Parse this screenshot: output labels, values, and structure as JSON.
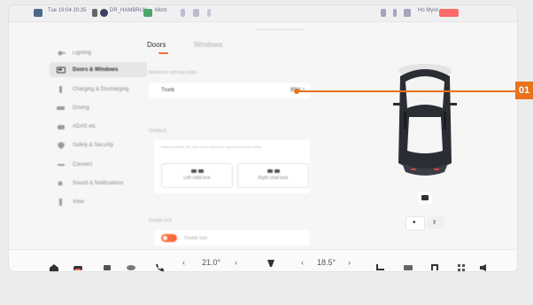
{
  "status_bar": {
    "time": "Tue 19:04 20:35",
    "driver": "DR_HAMBRUK",
    "network": "Mont",
    "right_label": "Ho Myrd",
    "brand_accent": "#ff6a3d"
  },
  "sidebar": {
    "items": [
      {
        "label": "Lighting",
        "icon": "light-icon"
      },
      {
        "label": "Doors & Windows",
        "icon": "car-door-icon"
      },
      {
        "label": "Charging & Discharging",
        "icon": "plug-icon"
      },
      {
        "label": "Driving",
        "icon": "steering-icon"
      },
      {
        "label": "ADAS etc",
        "icon": "adas-icon"
      },
      {
        "label": "Safety & Security",
        "icon": "shield-icon"
      },
      {
        "label": "Connect",
        "icon": "link-icon"
      },
      {
        "label": "Sound & Notifications",
        "icon": "speaker-icon"
      },
      {
        "label": "View",
        "icon": "info-icon"
      }
    ],
    "active_index": 1
  },
  "tabs": [
    {
      "label": "Doors",
      "active": true
    },
    {
      "label": "Windows",
      "active": false
    }
  ],
  "main": {
    "opening_angle_label": "Maximum opening angle",
    "trunk_label": "Trunk",
    "trunk_value": "85%",
    "trunk_chevron": "›",
    "childlock_label": "Childlock",
    "childlock_note": "When enabled, the rear doors cannot be opened from the inside",
    "left_child_lock": "Left child lock",
    "right_child_lock": "Right child lock",
    "double_lock_label": "Double lock",
    "double_lock_toggle": "Double lock",
    "double_lock_on": true
  },
  "car_view": {
    "view_buttons": [
      "●",
      "▮"
    ]
  },
  "dock": {
    "left_temp": "21.0°",
    "right_temp": "18.5°",
    "left_arrow": "‹",
    "left_arrow2": "›",
    "right_arrow": "‹",
    "right_arrow2": "›"
  },
  "callout": {
    "number": "01",
    "color": "#e8731a"
  }
}
